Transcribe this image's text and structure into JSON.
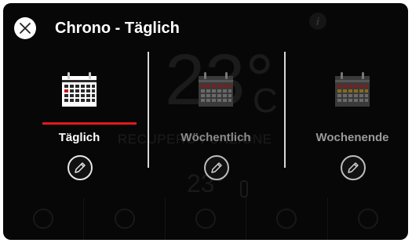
{
  "header": {
    "title": "Chrono - Täglich"
  },
  "modes": [
    {
      "label": "Täglich",
      "selected": true,
      "color": "#ffffff",
      "icon": "calendar-icon"
    },
    {
      "label": "Wöchentlich",
      "selected": false,
      "color": "#8a8a8a",
      "icon": "calendar-icon"
    },
    {
      "label": "Wochenende",
      "selected": false,
      "color": "#9a9a9a",
      "icon": "calendar-icon"
    }
  ],
  "background": {
    "temperature": "23°",
    "unit": "C",
    "status": "RECUPERO FUNZIONE",
    "setpoint": "23°"
  },
  "colors": {
    "accent": "#e0191e",
    "background": "#070707",
    "text": "#ffffff"
  }
}
